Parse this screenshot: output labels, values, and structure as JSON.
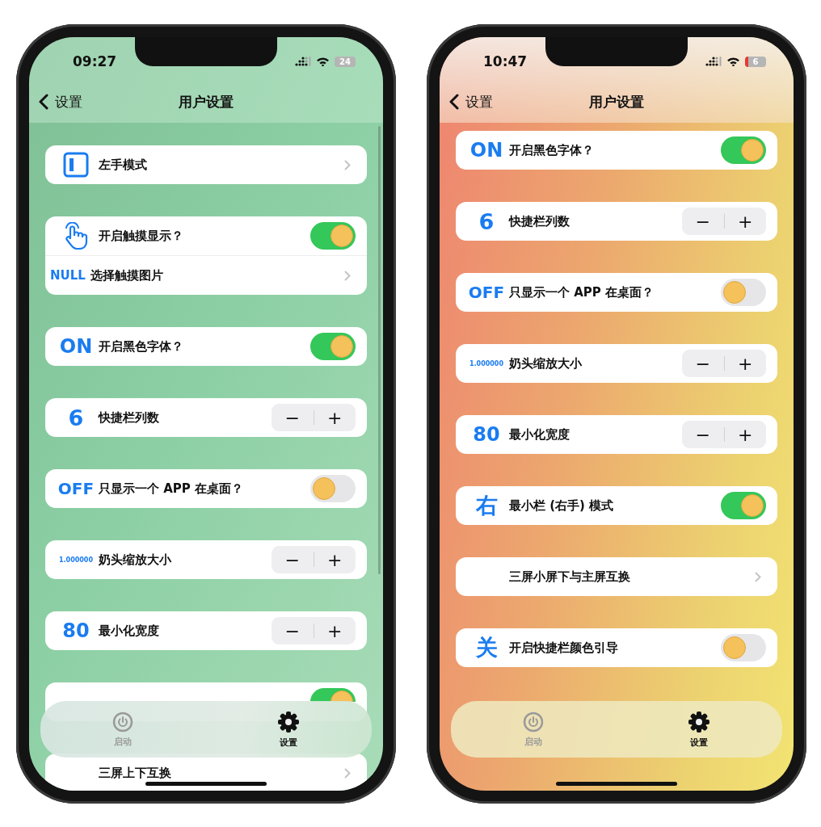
{
  "phones": [
    {
      "scroll_indicator": true,
      "status": {
        "time": "09:27",
        "battery": "24",
        "battery_low": false
      },
      "nav": {
        "back": "设置",
        "title": "用户设置"
      },
      "cards": [
        {
          "rows": [
            {
              "kind": "mode",
              "label": "左手模式"
            }
          ]
        },
        {
          "rows": [
            {
              "kind": "touch",
              "label": "开启触摸显示？",
              "on": true
            },
            {
              "kind": "link",
              "badge": "NULL",
              "label": "选择触摸图片"
            }
          ]
        },
        {
          "rows": [
            {
              "kind": "toggle",
              "badge": "ON",
              "label": "开启黑色字体？",
              "on": true
            }
          ]
        },
        {
          "rows": [
            {
              "kind": "stepper",
              "badge": "6",
              "label": "快捷栏列数",
              "minus": "−",
              "plus": "+"
            }
          ]
        },
        {
          "rows": [
            {
              "kind": "toggle",
              "badge": "OFF",
              "label": "只显示一个 APP 在桌面？",
              "on": false
            }
          ]
        },
        {
          "rows": [
            {
              "kind": "stepper",
              "badge": "1.000000",
              "label": "奶头缩放大小",
              "minus": "−",
              "plus": "+"
            }
          ]
        },
        {
          "rows": [
            {
              "kind": "stepper",
              "badge": "80",
              "label": "最小化宽度",
              "minus": "−",
              "plus": "+"
            }
          ]
        },
        {
          "rows": [
            {
              "kind": "peek",
              "on": true
            }
          ]
        },
        {
          "rows": [
            {
              "kind": "link",
              "label": "三屏上下互换"
            }
          ]
        }
      ],
      "tabs": [
        {
          "label": "启动",
          "selected": false
        },
        {
          "label": "设置",
          "selected": true
        }
      ]
    },
    {
      "scroll_indicator": false,
      "status": {
        "time": "10:47",
        "battery": "6",
        "battery_low": true
      },
      "nav": {
        "back": "设置",
        "title": "用户设置"
      },
      "cards": [
        {
          "rows": [
            {
              "kind": "toggle",
              "badge": "ON",
              "label": "开启黑色字体？",
              "on": true
            }
          ]
        },
        {
          "rows": [
            {
              "kind": "stepper",
              "badge": "6",
              "label": "快捷栏列数",
              "minus": "−",
              "plus": "+"
            }
          ]
        },
        {
          "rows": [
            {
              "kind": "toggle",
              "badge": "OFF",
              "label": "只显示一个 APP 在桌面？",
              "on": false
            }
          ]
        },
        {
          "rows": [
            {
              "kind": "stepper",
              "badge": "1.000000",
              "label": "奶头缩放大小",
              "minus": "−",
              "plus": "+"
            }
          ]
        },
        {
          "rows": [
            {
              "kind": "stepper",
              "badge": "80",
              "label": "最小化宽度",
              "minus": "−",
              "plus": "+"
            }
          ]
        },
        {
          "rows": [
            {
              "kind": "toggle",
              "badge": "右",
              "label": "最小栏 (右手) 模式",
              "on": true
            }
          ]
        },
        {
          "rows": [
            {
              "kind": "link",
              "label": "三屏小屏下与主屏互换"
            }
          ]
        },
        {
          "rows": [
            {
              "kind": "toggle",
              "badge": "关",
              "label": "开启快捷栏颜色引导",
              "on": false
            }
          ]
        }
      ],
      "tabs": [
        {
          "label": "启动",
          "selected": false
        },
        {
          "label": "设置",
          "selected": true
        }
      ]
    }
  ]
}
